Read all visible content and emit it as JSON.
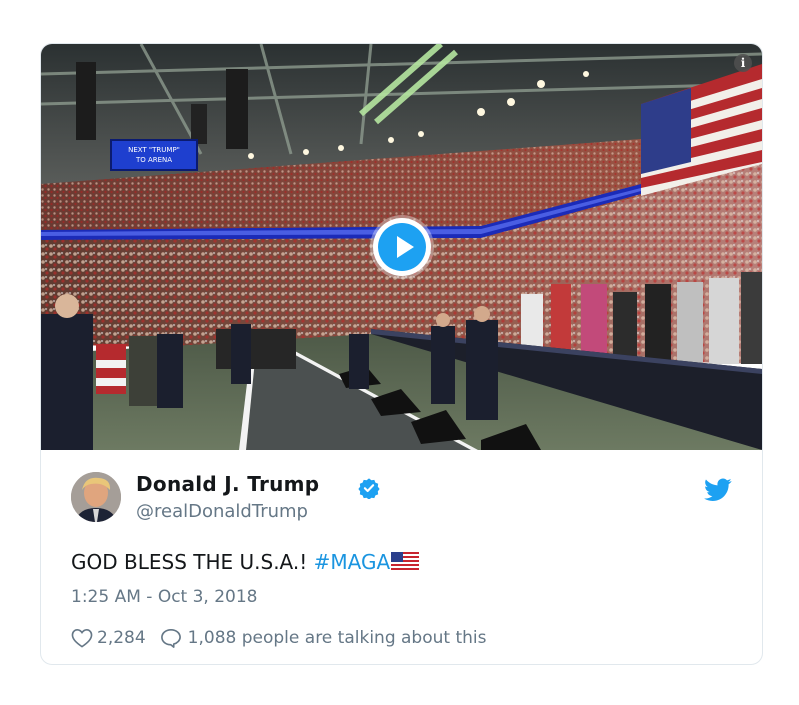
{
  "tweet": {
    "author_name": "Donald J. Trump",
    "handle": "@realDonaldTrump",
    "text_main": "GOD BLESS THE U.S.A.! ",
    "hashtag": "#MAGA",
    "timestamp": "1:25 AM - Oct 3, 2018",
    "likes": "2,284",
    "conversation": "1,088 people are talking about this"
  },
  "media": {
    "scoreboard_text": "NEXT \"TRUMP\" TO ARENA",
    "has_play_button": true
  },
  "colors": {
    "accent": "#1da1f2",
    "hashtag": "#1b95e0",
    "secondary_text": "#657786",
    "primary_text": "#14171a",
    "border": "#e1e8ed"
  },
  "icons": [
    "info-icon",
    "play-icon",
    "verified-badge-icon",
    "twitter-bird-icon",
    "us-flag-emoji",
    "heart-icon",
    "speech-bubble-icon"
  ]
}
